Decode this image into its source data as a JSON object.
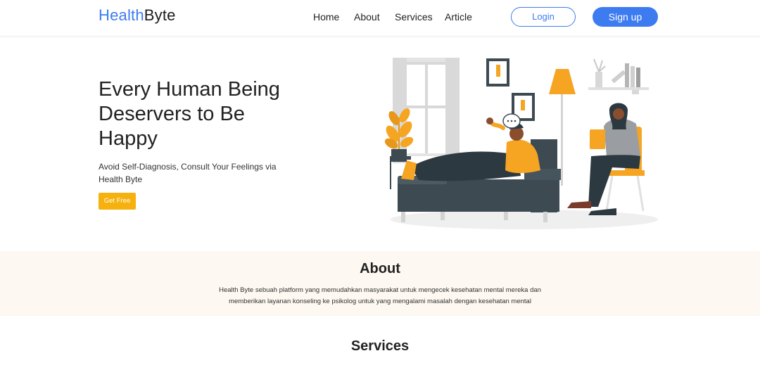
{
  "header": {
    "brand_part1": "Health",
    "brand_part2": "Byte",
    "nav": [
      "Home",
      "About",
      "Services",
      "Article"
    ],
    "login_label": "Login",
    "signup_label": "Sign up",
    "accent_color": "#3d7cf0"
  },
  "hero": {
    "title": "Every Human Being Deservers to Be Happy",
    "subtitle": "Avoid Self-Diagnosis, Consult Your Feelings via Health Byte",
    "cta_label": "Get Free",
    "cta_color": "#f6b10e"
  },
  "about": {
    "title": "About",
    "text": "Health Byte sebuah platform yang memudahkan masyarakat untuk mengecek kesehatan mental mereka dan memberikan layanan konseling ke psikolog untuk yang mengalami masalah dengan kesehatan mental"
  },
  "services": {
    "title": "Services"
  }
}
